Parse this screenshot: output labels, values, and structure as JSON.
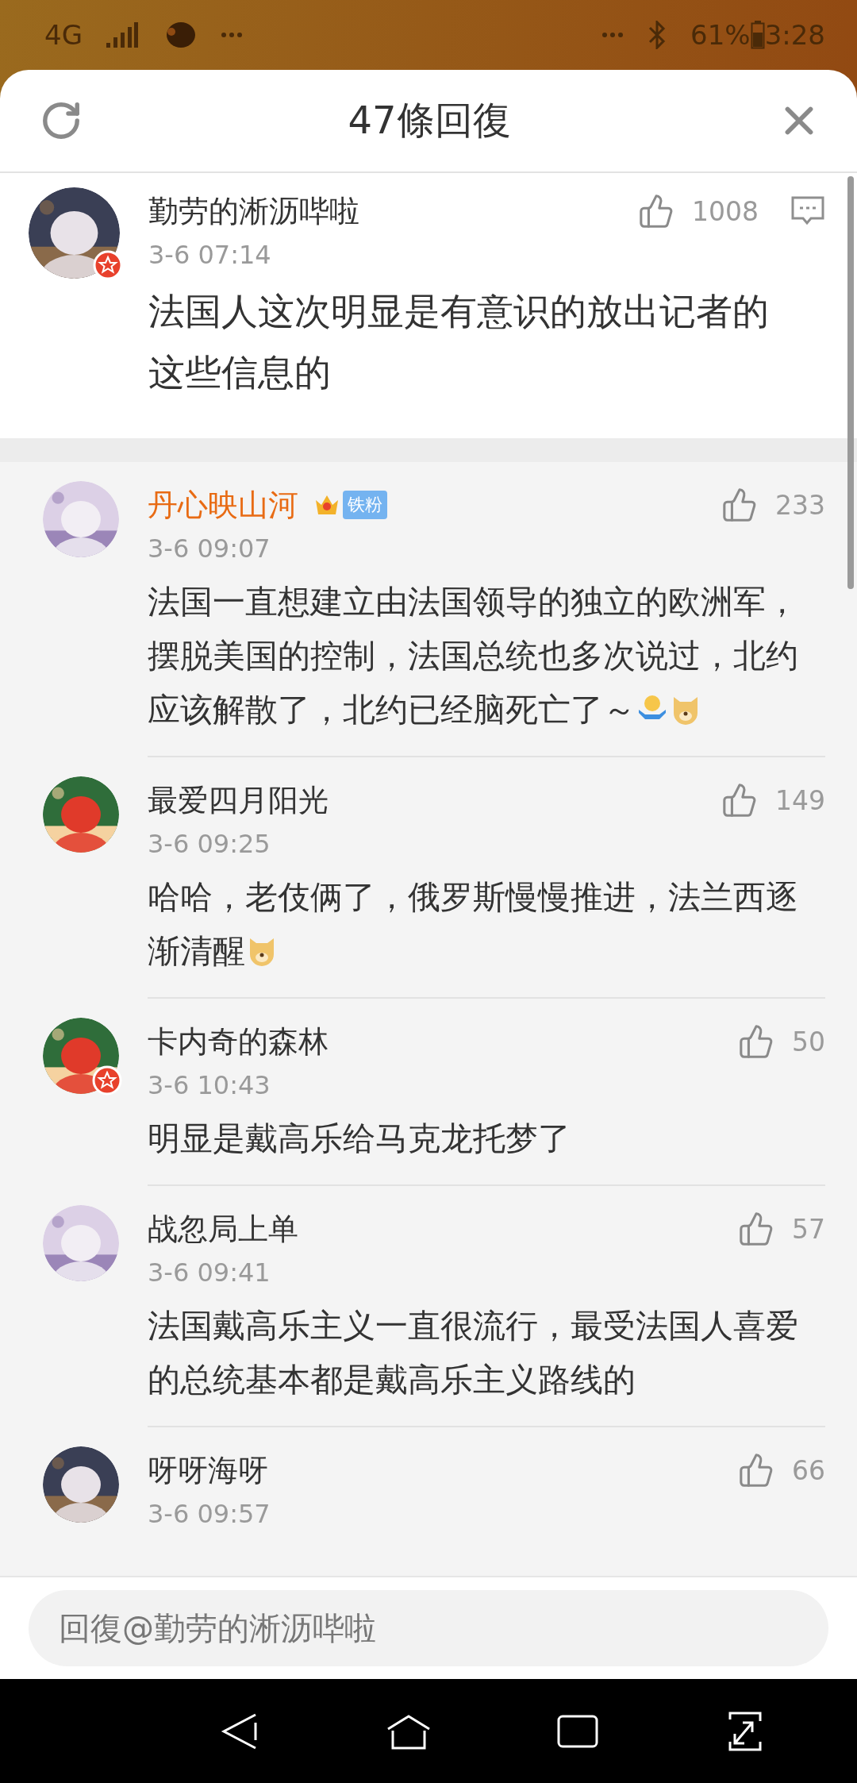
{
  "status_bar": {
    "network": "4G",
    "battery": "61%",
    "time": "3:28"
  },
  "header": {
    "title": "47條回復"
  },
  "main_comment": {
    "author": "勤劳的淅沥哔啦",
    "verified": true,
    "likes": "1008",
    "time": "3-6 07:14",
    "text": "法国人这次明显是有意识的放出记者的这些信息的"
  },
  "replies": [
    {
      "author": "丹心映山河",
      "vip": true,
      "verified": false,
      "badge": "铁粉",
      "likes": "233",
      "time": "3-6 09:07",
      "text": "法国一直想建立由法国领导的独立的欧洲军，摆脱美国的控制，法国总统也多次说过，北约应该解散了，北约已经脑死亡了～",
      "emojis": [
        {
          "kind": "shrug"
        },
        {
          "kind": "doge"
        }
      ]
    },
    {
      "author": "最爱四月阳光",
      "vip": false,
      "verified": false,
      "likes": "149",
      "time": "3-6 09:25",
      "text": "哈哈，老伎俩了，俄罗斯慢慢推进，法兰西逐渐清醒",
      "emojis": [
        {
          "kind": "doge"
        }
      ]
    },
    {
      "author": "卡内奇的森林",
      "vip": false,
      "verified": true,
      "likes": "50",
      "time": "3-6 10:43",
      "text": "明显是戴高乐给马克龙托梦了"
    },
    {
      "author": "战忽局上单",
      "vip": false,
      "verified": false,
      "likes": "57",
      "time": "3-6 09:41",
      "text": "法国戴高乐主义一直很流行，最受法国人喜爱的总统基本都是戴高乐主义路线的"
    },
    {
      "author": "呀呀海呀",
      "vip": false,
      "verified": false,
      "likes": "66",
      "time": "3-6 09:57"
    }
  ],
  "reply_box": {
    "placeholder": "回復@勤劳的淅沥哔啦"
  }
}
